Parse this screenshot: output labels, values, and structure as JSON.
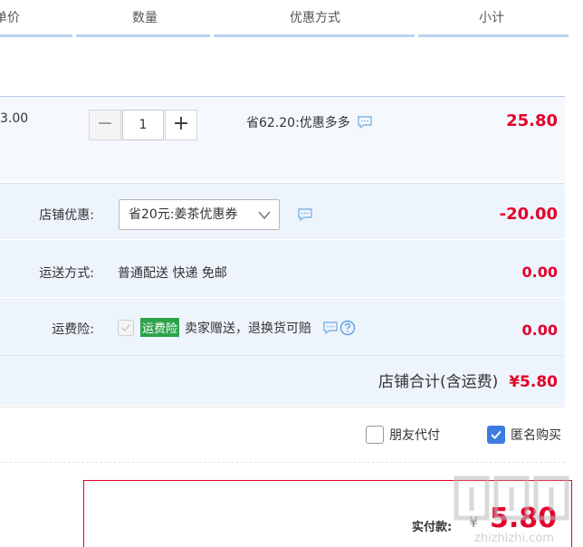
{
  "header": {
    "col_price": "单价",
    "col_qty": "数量",
    "col_discount": "优惠方式",
    "col_subtotal": "小计"
  },
  "item": {
    "unit_price_fragment": "3.00",
    "quantity": "1",
    "minus": "−",
    "plus": "+",
    "promo": "省62.20:优惠多多",
    "subtotal": "25.80"
  },
  "shop": {
    "coupon_label": "店铺优惠:",
    "coupon_selected": "省20元:姜茶优惠券",
    "coupon_amount": "-20.00",
    "shipping_label": "运送方式:",
    "shipping_value": "普通配送 快递 免邮",
    "shipping_amount": "0.00",
    "insurance_label": "运费险:",
    "insurance_tag": "运费险",
    "insurance_desc": "卖家赠送，退换货可赔",
    "insurance_amount": "0.00",
    "total_label": "店铺合计(含运费)",
    "total_amount": "¥5.80"
  },
  "options": {
    "friend_pay": "朋友代付",
    "anonymous": "匿名购买",
    "friend_pay_checked": false,
    "anonymous_checked": true
  },
  "payment": {
    "label": "实付款:",
    "currency": "¥",
    "amount": "5.80"
  },
  "watermark": {
    "text": "zhizhizhi.com"
  },
  "colors": {
    "price_red": "#e4002b",
    "accent_blue": "#3d7ce0",
    "tag_green": "#2ea24a"
  }
}
